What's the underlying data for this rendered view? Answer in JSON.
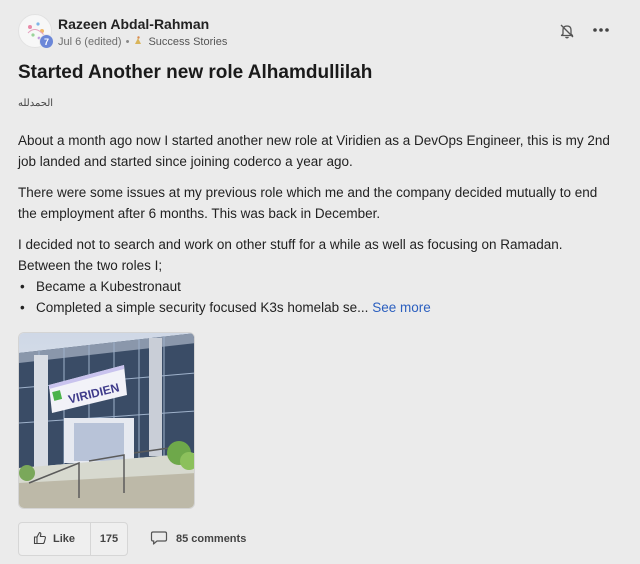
{
  "post": {
    "author": "Razeen Abdal-Rahman",
    "level": "7",
    "date": "Jul 6 (edited)",
    "separator": "•",
    "category": "Success Stories",
    "title": "Started Another new role Alhamdullilah",
    "arabic": "الحمدلله",
    "paragraphs": [
      "About a month ago now I started another new role at Viridien as a DevOps Engineer, this is my 2nd job landed and started since joining coderco a year ago.",
      "There were some issues at my previous role which me and the company decided mutually to end the employment after 6 months. This was back in December.",
      "I decided not to search and work on other stuff for a while as well as focusing on Ramadan. Between the two roles I;"
    ],
    "bullets": [
      "Became a Kubestronaut",
      "Completed a simple security focused K3s homelab se..."
    ],
    "see_more": "See more",
    "image_sign_text": "VIRIDIEN"
  },
  "actions": {
    "like_label": "Like",
    "like_count": "175",
    "comments_label": "85 comments"
  },
  "icons": {
    "bell": "bell-off-icon",
    "more": "more-dots-icon",
    "like": "thumbs-up-icon",
    "comment": "comment-bubble-icon"
  },
  "colors": {
    "background": "#ebebeb",
    "link": "#2b5fbf",
    "level_badge": "#6b87d8"
  }
}
